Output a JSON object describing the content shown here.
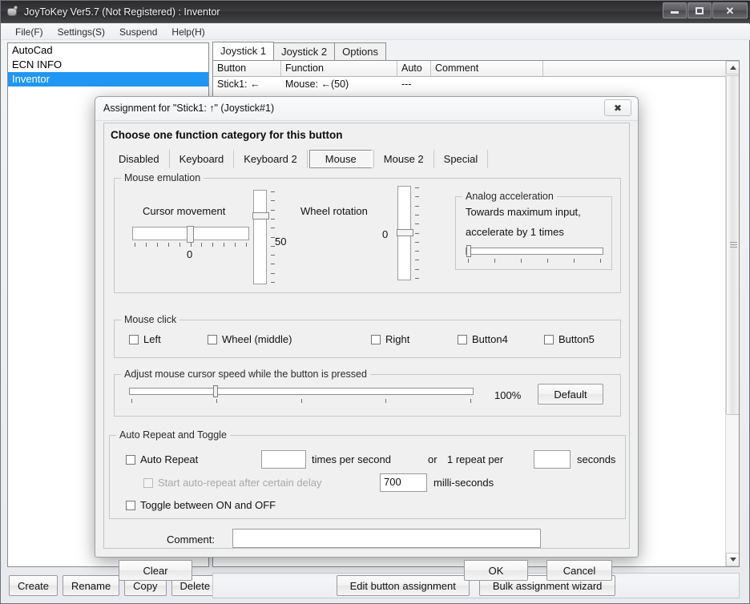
{
  "window": {
    "title": "JoyToKey Ver5.7 (Not Registered) : Inventor",
    "icon": "joystick-icon",
    "controls": {
      "minimize": "–",
      "maximize": "□",
      "close": "✕"
    }
  },
  "menu": {
    "items": [
      "File(F)",
      "Settings(S)",
      "Suspend",
      "Help(H)"
    ]
  },
  "profiles": {
    "items": [
      {
        "label": "AutoCad",
        "selected": false
      },
      {
        "label": "ECN INFO",
        "selected": false
      },
      {
        "label": "Inventor",
        "selected": true
      }
    ]
  },
  "tabs": {
    "items": [
      "Joystick 1",
      "Joystick 2",
      "Options"
    ],
    "active": "Joystick 1"
  },
  "table": {
    "columns": [
      "Button",
      "Function",
      "Auto",
      "Comment",
      ""
    ],
    "rows": [
      {
        "button": "Stick1: ←",
        "function": "Mouse: ←(50)",
        "auto": "---",
        "comment": ""
      }
    ]
  },
  "bottom_bar": {
    "left_buttons": [
      "Create",
      "Rename",
      "Copy",
      "Delete"
    ],
    "right_buttons": [
      "Edit button assignment",
      "Bulk assignment wizard"
    ]
  },
  "dialog": {
    "title": "Assignment for \"Stick1: ↑\" (Joystick#1)",
    "close_glyph": "✖",
    "heading": "Choose one function category for this button",
    "category_tabs": {
      "items": [
        "Disabled",
        "Keyboard",
        "Keyboard 2",
        "Mouse",
        "Mouse 2",
        "Special"
      ],
      "selected": "Mouse"
    },
    "mouse_emulation": {
      "legend": "Mouse emulation",
      "cursor_movement": {
        "label": "Cursor movement",
        "value": "0",
        "ticks": 11
      },
      "wheel_rotation": {
        "label": "Wheel rotation",
        "value": "50",
        "ticks": 11
      },
      "secondary_vertical": {
        "value": "0",
        "ticks": 11
      },
      "analog_acceleration": {
        "legend": "Analog acceleration",
        "line1": "Towards maximum input,",
        "line2": "accelerate by 1 times",
        "value": 1,
        "ticks": 6
      }
    },
    "mouse_click": {
      "legend": "Mouse click",
      "options": [
        {
          "label": "Left",
          "checked": false
        },
        {
          "label": "Wheel (middle)",
          "checked": false
        },
        {
          "label": "Right",
          "checked": false
        },
        {
          "label": "Button4",
          "checked": false
        },
        {
          "label": "Button5",
          "checked": false
        }
      ]
    },
    "cursor_speed": {
      "legend": "Adjust mouse cursor speed while the button is pressed",
      "value_text": "100%",
      "default_button": "Default",
      "ticks": 5
    },
    "auto_repeat": {
      "legend": "Auto Repeat and Toggle",
      "auto_repeat_label": "Auto Repeat",
      "auto_repeat_checked": false,
      "times_per_second_value": "",
      "times_per_second_label": "times per second",
      "or_label": "or",
      "one_repeat_per_label": "1 repeat per",
      "seconds_value": "",
      "seconds_label": "seconds",
      "delay_label": "Start auto-repeat after certain delay",
      "delay_checked": false,
      "delay_value": "700",
      "delay_units": "milli-seconds",
      "toggle_label": "Toggle between ON and OFF",
      "toggle_checked": false
    },
    "comment": {
      "label": "Comment:",
      "value": "",
      "placeholder": ""
    },
    "buttons": {
      "clear": "Clear",
      "ok": "OK",
      "cancel": "Cancel"
    }
  },
  "colors": {
    "selection_blue": "#2196f3",
    "dialog_bg": "#f0f0f0",
    "titlebar_dark": "#2f2f31"
  }
}
